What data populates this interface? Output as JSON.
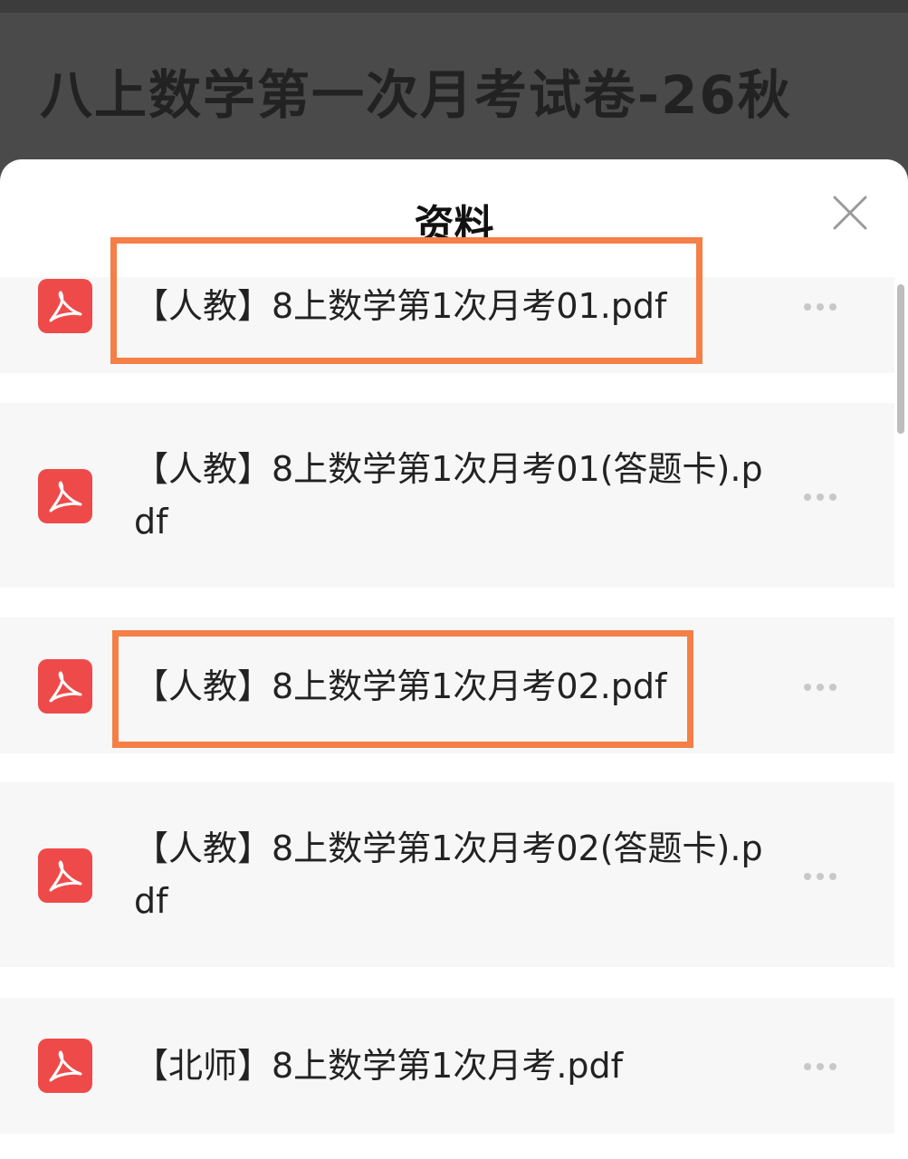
{
  "page": {
    "title": "八上数学第一次月考试卷-26秋"
  },
  "sheet": {
    "title": "资料",
    "close_icon": "close-icon"
  },
  "files": [
    {
      "name": "【人教】8上数学第1次月考01.pdf",
      "icon": "pdf-icon",
      "more_icon": "more-icon",
      "highlighted": true
    },
    {
      "name": "【人教】8上数学第1次月考01(答题卡).pdf",
      "icon": "pdf-icon",
      "more_icon": "more-icon",
      "highlighted": false
    },
    {
      "name": "【人教】8上数学第1次月考02.pdf",
      "icon": "pdf-icon",
      "more_icon": "more-icon",
      "highlighted": true
    },
    {
      "name": "【人教】8上数学第1次月考02(答题卡).pdf",
      "icon": "pdf-icon",
      "more_icon": "more-icon",
      "highlighted": false
    },
    {
      "name": "【北师】8上数学第1次月考.pdf",
      "icon": "pdf-icon",
      "more_icon": "more-icon",
      "highlighted": false
    }
  ],
  "colors": {
    "highlight": "#f47f47",
    "pdf_icon": "#ef4a4a",
    "item_background": "#f7f7f7",
    "backdrop": "#4a4a4a"
  }
}
